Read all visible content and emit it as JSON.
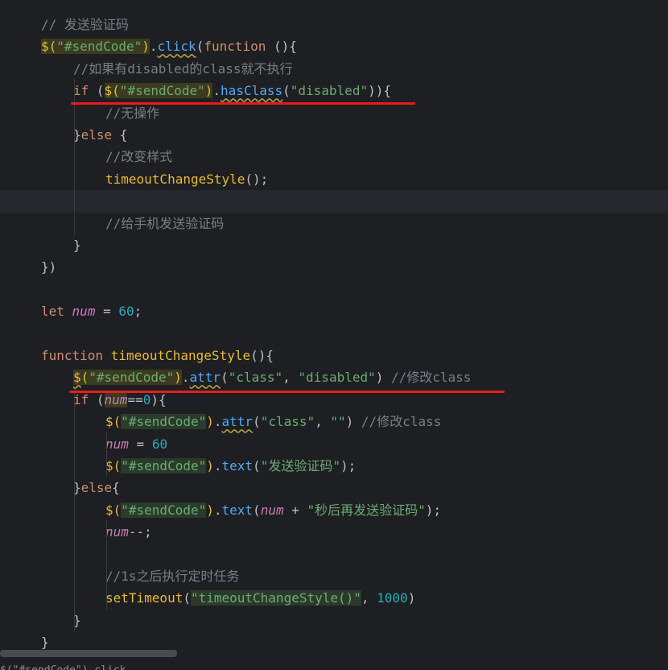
{
  "editor": {
    "language": "javascript",
    "lines": [
      {
        "indent": 1,
        "tokens": [
          [
            "cmt",
            "// 发送验证码"
          ]
        ]
      },
      {
        "indent": 1,
        "tokens": [
          [
            "fn2 hl",
            "$("
          ],
          [
            "str hl",
            "\"#sendCode\""
          ],
          [
            "fn2 hl",
            ")"
          ],
          [
            "plain",
            "."
          ],
          [
            "mth squig",
            "click"
          ],
          [
            "plain",
            "("
          ],
          [
            "kw",
            "function"
          ],
          [
            "plain",
            " (){"
          ]
        ]
      },
      {
        "indent": 2,
        "tokens": [
          [
            "cmt",
            "//如果有disabled的class就不执行"
          ]
        ]
      },
      {
        "indent": 2,
        "tokens": [
          [
            "kw",
            "if"
          ],
          [
            "plain",
            " ("
          ],
          [
            "fn2 hl",
            "$("
          ],
          [
            "str hl",
            "\"#sendCode\""
          ],
          [
            "fn2 hl",
            ")"
          ],
          [
            "plain",
            "."
          ],
          [
            "mth squig",
            "hasClass"
          ],
          [
            "plain",
            "("
          ],
          [
            "str",
            "\"disabled\""
          ],
          [
            "plain",
            ")){"
          ]
        ]
      },
      {
        "indent": 3,
        "tokens": [
          [
            "cmt",
            "//无操作"
          ]
        ]
      },
      {
        "indent": 2,
        "tokens": [
          [
            "plain",
            "}"
          ],
          [
            "kw",
            "else"
          ],
          [
            "plain",
            " {"
          ]
        ]
      },
      {
        "indent": 3,
        "tokens": [
          [
            "cmt",
            "//改变样式"
          ]
        ]
      },
      {
        "indent": 3,
        "tokens": [
          [
            "fn2",
            "timeoutChangeStyle"
          ],
          [
            "plain",
            "();"
          ]
        ]
      },
      {
        "indent": 3,
        "current": true,
        "tokens": []
      },
      {
        "indent": 3,
        "tokens": [
          [
            "cmt",
            "//给手机发送验证码"
          ]
        ]
      },
      {
        "indent": 2,
        "tokens": [
          [
            "plain",
            "}"
          ]
        ]
      },
      {
        "indent": 1,
        "tokens": [
          [
            "plain",
            "})"
          ]
        ]
      },
      {
        "indent": 1,
        "tokens": []
      },
      {
        "indent": 1,
        "tokens": [
          [
            "kw",
            "let"
          ],
          [
            "plain",
            " "
          ],
          [
            "var",
            "num"
          ],
          [
            "plain",
            " = "
          ],
          [
            "num",
            "60"
          ],
          [
            "plain",
            ";"
          ]
        ]
      },
      {
        "indent": 1,
        "tokens": []
      },
      {
        "indent": 1,
        "tokens": [
          [
            "kw",
            "function"
          ],
          [
            "plain",
            " "
          ],
          [
            "fn2",
            "timeoutChangeStyle"
          ],
          [
            "plain",
            "(){"
          ]
        ]
      },
      {
        "indent": 2,
        "tokens": [
          [
            "fn2 hl squig",
            "$"
          ],
          [
            "fn2 hl",
            "("
          ],
          [
            "str hl",
            "\"#sendCode\""
          ],
          [
            "fn2 hl",
            ")"
          ],
          [
            "plain",
            "."
          ],
          [
            "mth squig",
            "attr"
          ],
          [
            "plain",
            "("
          ],
          [
            "str",
            "\"class\""
          ],
          [
            "plain",
            ", "
          ],
          [
            "str",
            "\"disabled\""
          ],
          [
            "plain",
            ") "
          ],
          [
            "cmt",
            "//修改class"
          ]
        ]
      },
      {
        "indent": 2,
        "tokens": [
          [
            "kw",
            "if"
          ],
          [
            "plain",
            " ("
          ],
          [
            "var hl",
            "num"
          ],
          [
            "plain",
            "=="
          ],
          [
            "num",
            "0"
          ],
          [
            "plain",
            "){"
          ]
        ]
      },
      {
        "indent": 3,
        "tokens": [
          [
            "fn2",
            "$("
          ],
          [
            "str hlg",
            "\"#sendCode\""
          ],
          [
            "fn2",
            ")"
          ],
          [
            "plain",
            "."
          ],
          [
            "mth squig",
            "attr"
          ],
          [
            "plain",
            "("
          ],
          [
            "str",
            "\"class\""
          ],
          [
            "plain",
            ", "
          ],
          [
            "str",
            "\"\""
          ],
          [
            "plain",
            ") "
          ],
          [
            "cmt",
            "//修改class"
          ]
        ]
      },
      {
        "indent": 3,
        "tokens": [
          [
            "var",
            "num"
          ],
          [
            "plain",
            " = "
          ],
          [
            "num",
            "60"
          ]
        ]
      },
      {
        "indent": 3,
        "tokens": [
          [
            "fn2",
            "$("
          ],
          [
            "str hlg",
            "\"#sendCode\""
          ],
          [
            "fn2",
            ")"
          ],
          [
            "plain",
            "."
          ],
          [
            "mth",
            "text"
          ],
          [
            "plain",
            "("
          ],
          [
            "str",
            "\"发送验证码\""
          ],
          [
            "plain",
            ");"
          ]
        ]
      },
      {
        "indent": 2,
        "tokens": [
          [
            "plain",
            "}"
          ],
          [
            "kw",
            "else"
          ],
          [
            "plain",
            "{"
          ]
        ]
      },
      {
        "indent": 3,
        "tokens": [
          [
            "fn2",
            "$("
          ],
          [
            "str hlg",
            "\"#sendCode\""
          ],
          [
            "fn2",
            ")"
          ],
          [
            "plain",
            "."
          ],
          [
            "mth",
            "text"
          ],
          [
            "plain",
            "("
          ],
          [
            "var",
            "num"
          ],
          [
            "plain",
            " + "
          ],
          [
            "str",
            "\"秒后再发送验证码\""
          ],
          [
            "plain",
            ");"
          ]
        ]
      },
      {
        "indent": 3,
        "tokens": [
          [
            "var",
            "num"
          ],
          [
            "plain",
            "--;"
          ]
        ]
      },
      {
        "indent": 3,
        "tokens": []
      },
      {
        "indent": 3,
        "tokens": [
          [
            "cmt",
            "//1s之后执行定时任务"
          ]
        ]
      },
      {
        "indent": 3,
        "tokens": [
          [
            "fn2",
            "setTimeout"
          ],
          [
            "plain",
            "("
          ],
          [
            "str hlg",
            "\"timeoutChangeStyle()\""
          ],
          [
            "plain",
            ", "
          ],
          [
            "num",
            "1000"
          ],
          [
            "plain",
            ")"
          ]
        ]
      },
      {
        "indent": 2,
        "tokens": [
          [
            "plain",
            "}"
          ]
        ]
      },
      {
        "indent": 1,
        "tokens": [
          [
            "plain",
            "}"
          ]
        ]
      }
    ],
    "bottom_text": "$(\"#sendCode\").click"
  }
}
